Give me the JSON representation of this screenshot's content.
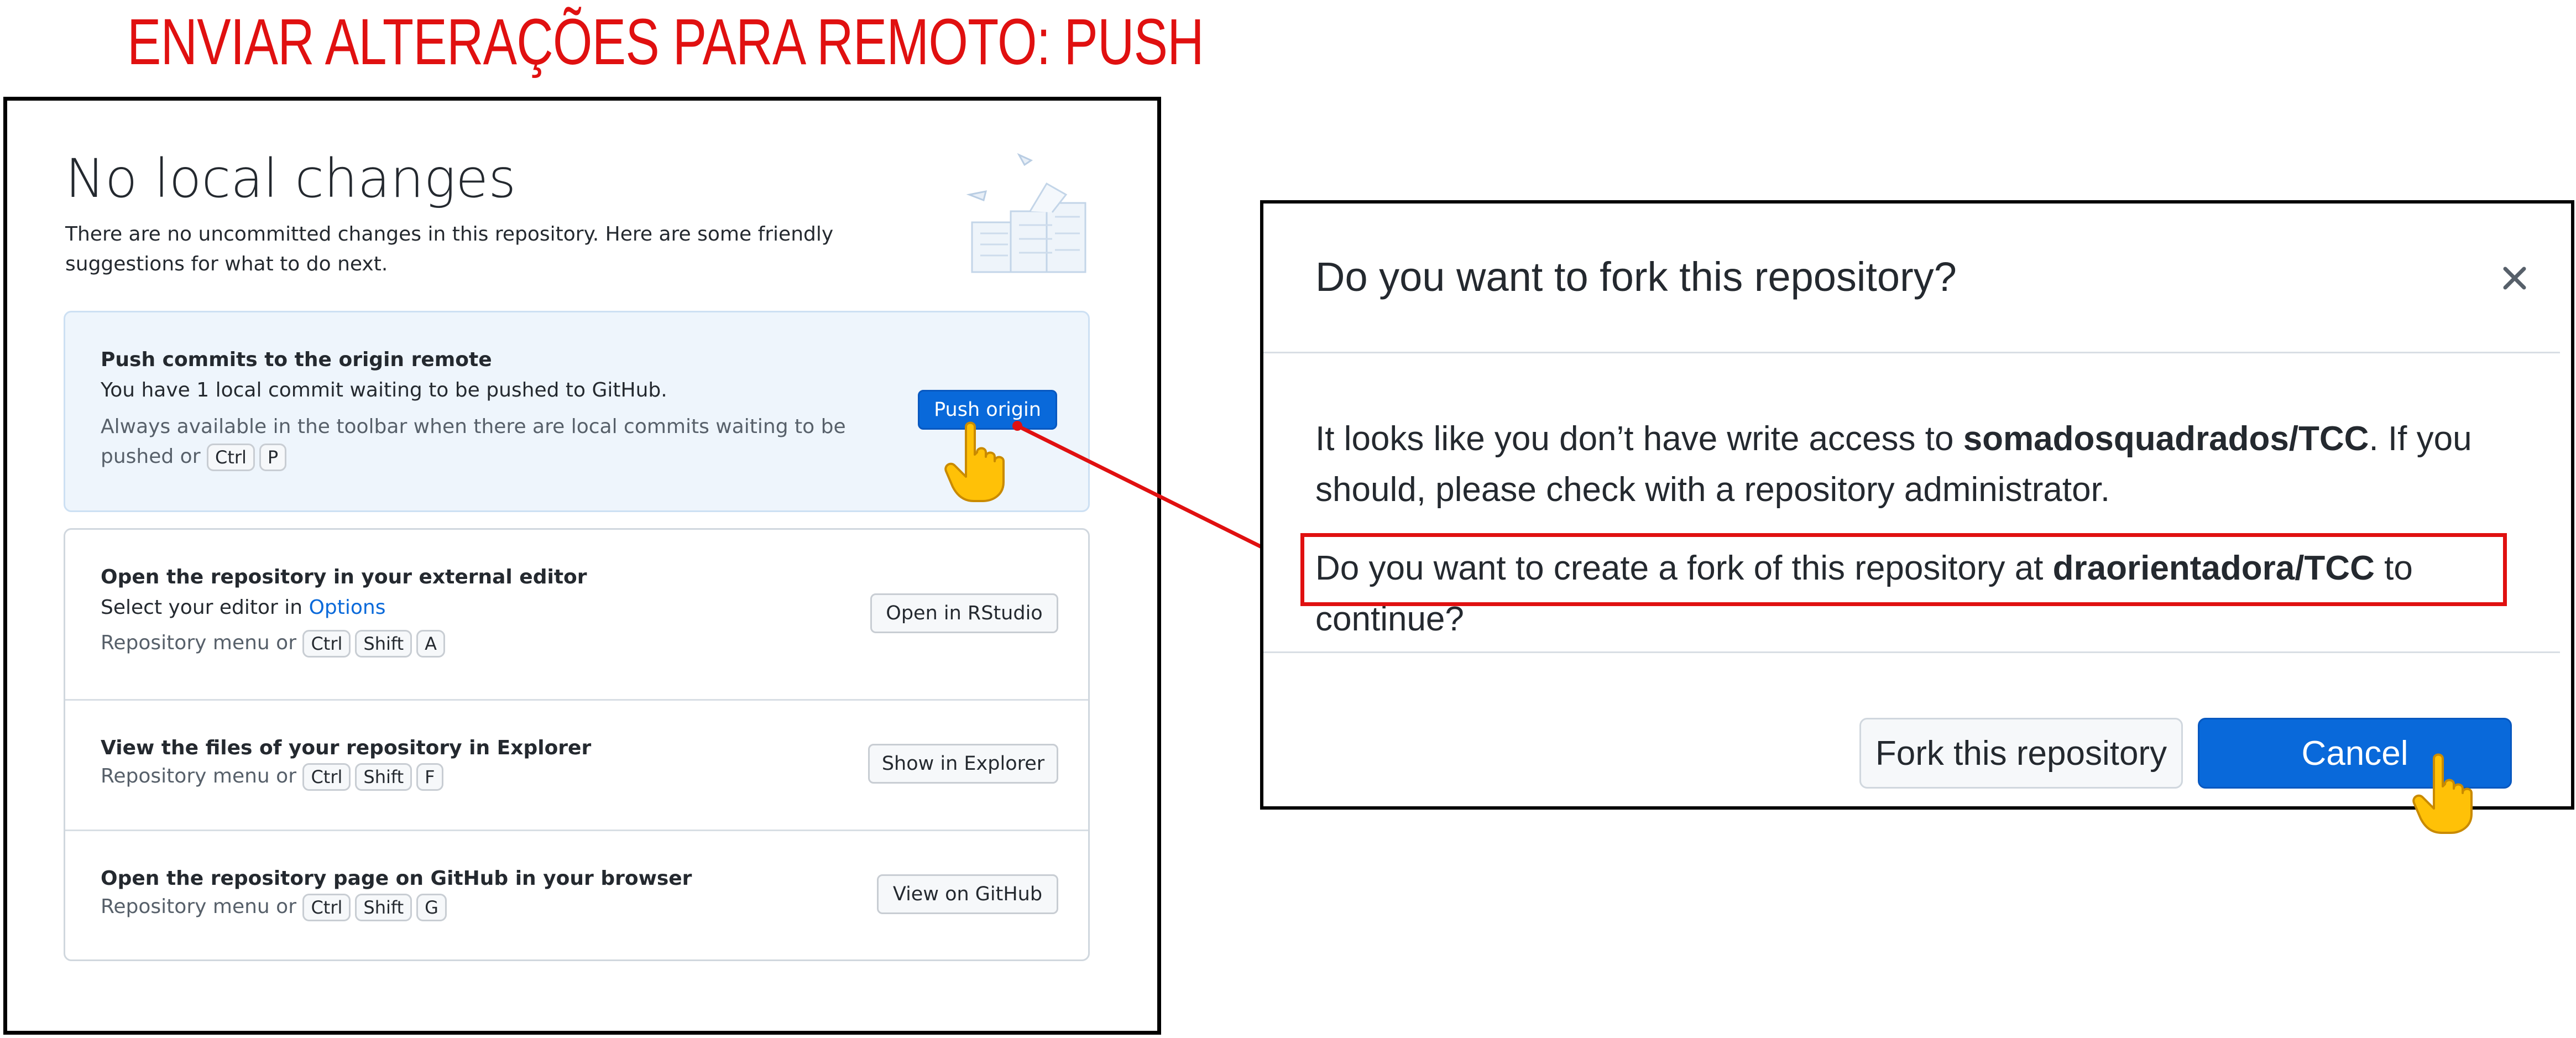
{
  "heading": "ENVIAR ALTERAÇÕES PARA REMOTO: PUSH",
  "left_panel": {
    "title": "No local changes",
    "description": "There are no uncommitted changes in this repository. Here are some friendly suggestions for what to do next.",
    "push_card": {
      "title": "Push commits to the origin remote",
      "text": "You have 1 local commit waiting to be pushed to GitHub.",
      "hint": "Always available in the toolbar when there are local commits waiting to be pushed or",
      "keys": [
        "Ctrl",
        "P"
      ],
      "button": "Push origin"
    },
    "editor_row": {
      "title": "Open the repository in your external editor",
      "text_prefix": "Select your editor in",
      "link": "Options",
      "hint": "Repository menu or",
      "keys": [
        "Ctrl",
        "Shift",
        "A"
      ],
      "button": "Open in RStudio"
    },
    "explorer_row": {
      "title": "View the files of your repository in Explorer",
      "hint": "Repository menu or",
      "keys": [
        "Ctrl",
        "Shift",
        "F"
      ],
      "button": "Show in Explorer"
    },
    "github_row": {
      "title": "Open the repository page on GitHub in your browser",
      "hint": "Repository menu or",
      "keys": [
        "Ctrl",
        "Shift",
        "G"
      ],
      "button": "View on GitHub"
    }
  },
  "dialog": {
    "title": "Do you want to fork this repository?",
    "close_icon": "close-icon",
    "message1_prefix": "It looks like you don’t have write access to",
    "message1_repo": "somadosquadrados/TCC",
    "message1_suffix": ". If you should, please check with a repository administrator.",
    "message2_prefix": "Do you want to create a fork of this repository at",
    "message2_repo": "draorientadora/TCC",
    "message2_suffix": "to continue?",
    "fork_button": "Fork this repository",
    "cancel_button": "Cancel"
  },
  "colors": {
    "accent": "#0969da",
    "highlight": "#e01010",
    "pointer_hand": "#ffc107"
  },
  "icons": [
    "pointer-hand-icon",
    "close-icon",
    "papers-illustration"
  ]
}
